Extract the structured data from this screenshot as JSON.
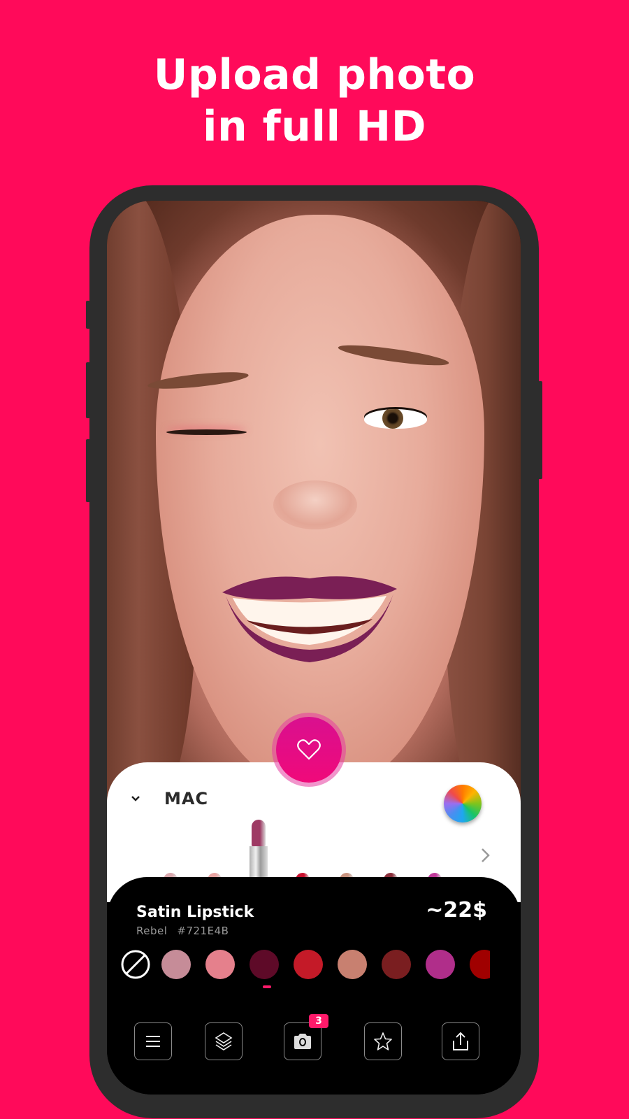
{
  "headline": {
    "line1": "Upload photo",
    "line2": "in full HD"
  },
  "colors": {
    "background": "#FF0A5A",
    "accent": "#FF1A6A",
    "phone_frame": "#2D2D2D",
    "lip_applied": "#721E4B"
  },
  "photo": {
    "subject": "woman winking with purple lipstick applied"
  },
  "favorite_button": {
    "icon": "heart-icon"
  },
  "brand_panel": {
    "brand": "MAC",
    "collapse_icon": "chevron-down-icon",
    "color_wheel_icon": "color-wheel-icon",
    "next_icon": "chevron-right-icon",
    "lipsticks": [
      {
        "shade": "#D9A7AC",
        "selected": false
      },
      {
        "shade": "#E8A4A2",
        "selected": false
      },
      {
        "shade": "#9E3A64",
        "selected": true
      },
      {
        "shade": "#C8102E",
        "selected": false
      },
      {
        "shade": "#C99480",
        "selected": false
      },
      {
        "shade": "#8A2E3A",
        "selected": false
      },
      {
        "shade": "#C03A9A",
        "selected": false
      }
    ]
  },
  "product": {
    "name": "Satin Lipstick",
    "shade_name": "Rebel",
    "shade_hex": "#721E4B",
    "price": "~22$"
  },
  "swatches": {
    "none_icon": "no-color-icon",
    "colors": [
      "#C68C98",
      "#E5808C",
      "#5E0A28",
      "#C41A28",
      "#C88070",
      "#7A1E20",
      "#B02E8A",
      "#A00000"
    ],
    "selected_index": 2
  },
  "toolbar": {
    "items": [
      {
        "icon": "menu-icon",
        "name": "menu"
      },
      {
        "icon": "layers-icon",
        "name": "layers"
      },
      {
        "icon": "camera-icon",
        "name": "camera",
        "badge": "3"
      },
      {
        "icon": "star-icon",
        "name": "favorites"
      },
      {
        "icon": "share-icon",
        "name": "share"
      }
    ]
  }
}
